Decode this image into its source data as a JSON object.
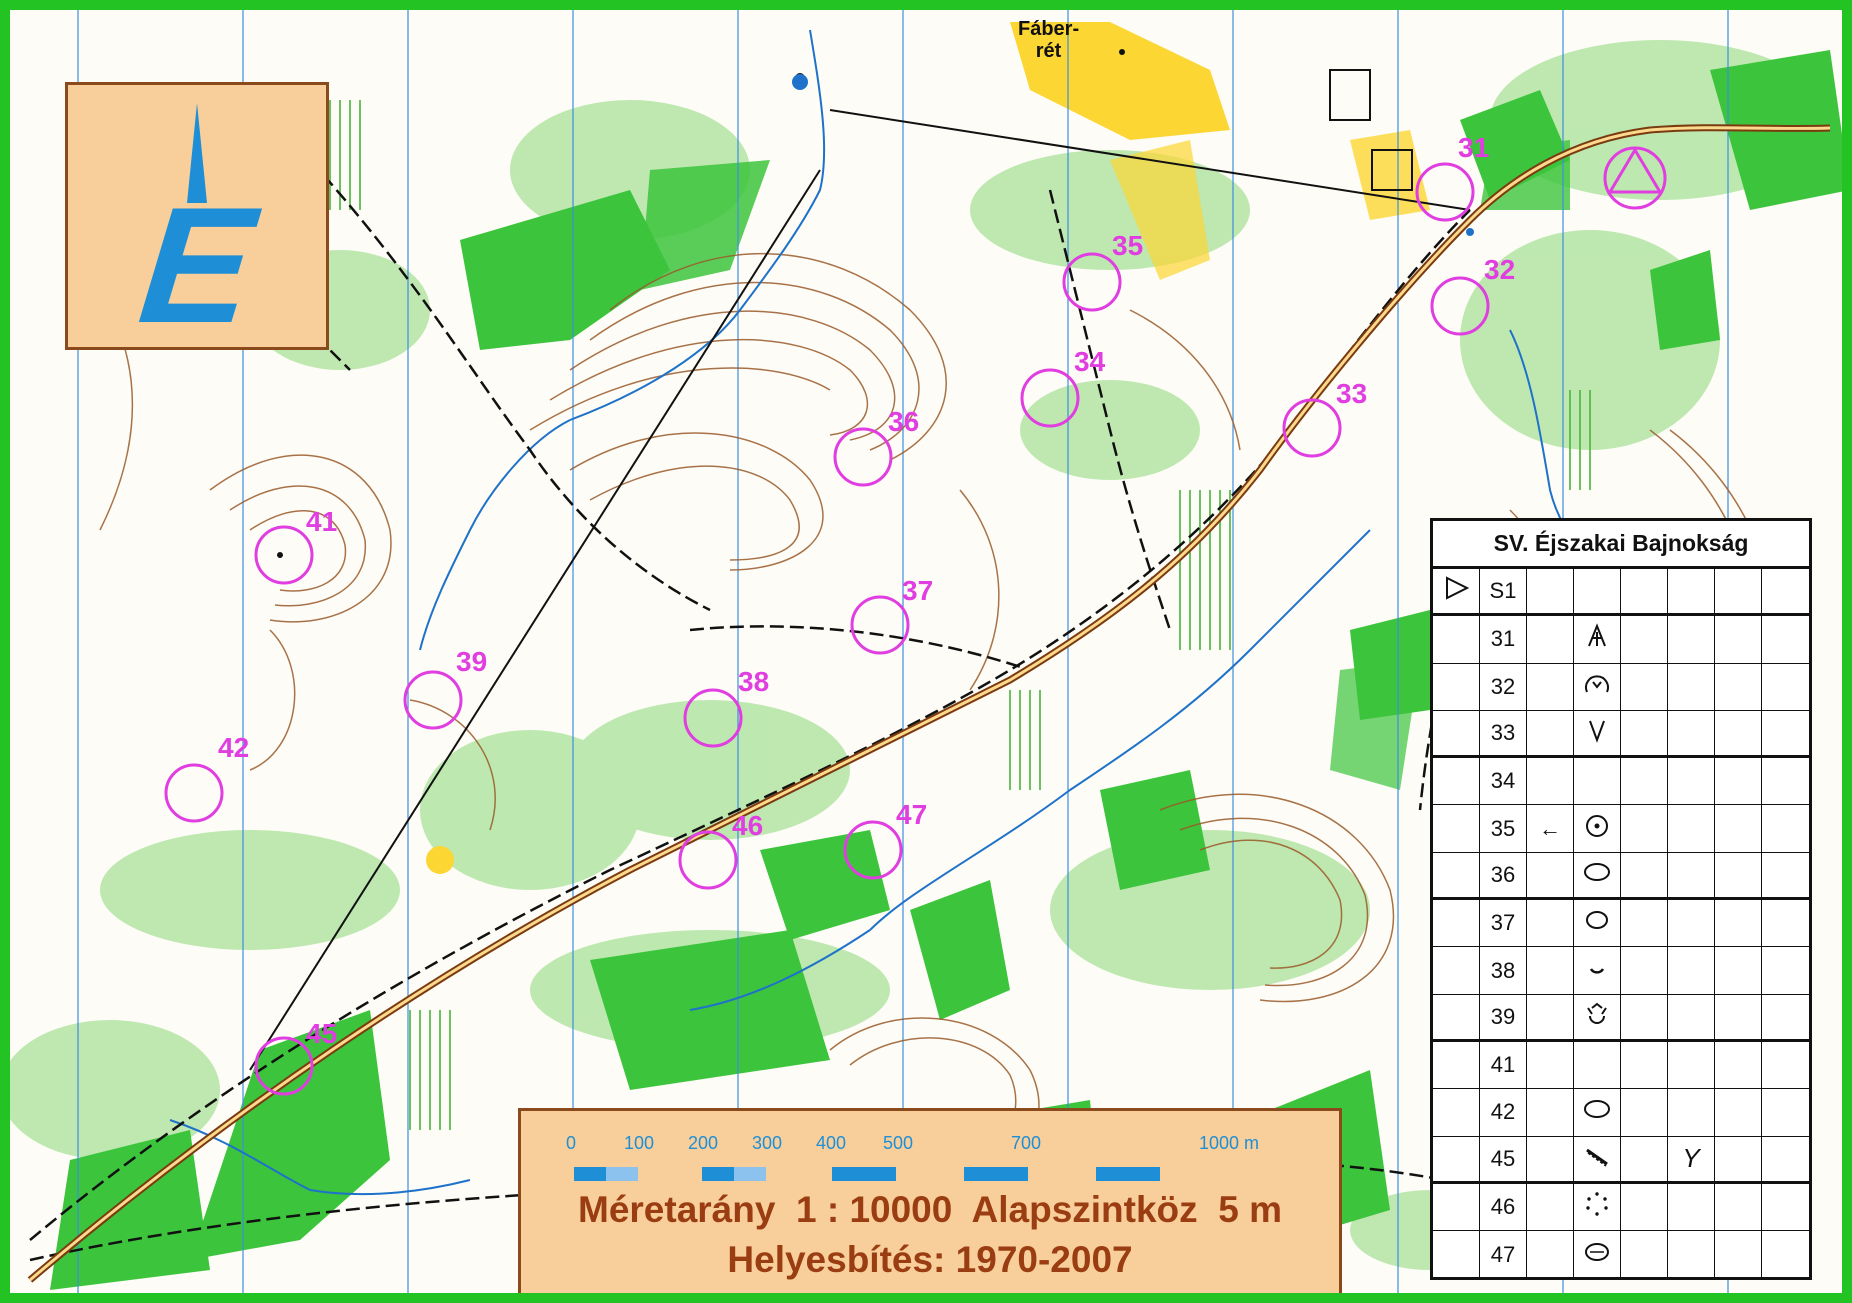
{
  "north_marker": {
    "letter": "E"
  },
  "place_labels": [
    "Fáber-",
    "rét"
  ],
  "controls": [
    "31",
    "32",
    "33",
    "34",
    "35",
    "36",
    "37",
    "38",
    "39",
    "41",
    "42",
    "45",
    "46",
    "47"
  ],
  "scale_box": {
    "ticks": [
      "0",
      "100",
      "200",
      "300",
      "400",
      "500",
      "700",
      "1000 m"
    ],
    "line1": "Méretarány  1 : 10000  Alapszintköz  5 m",
    "line2": "Helyesbítés: 1970-2007"
  },
  "control_descriptions": {
    "title": "SV. Éjszakai Bajnokság",
    "rows": [
      {
        "num": "S1",
        "dir": "",
        "feature": "start-triangle"
      },
      {
        "num": "31",
        "dir": "",
        "feature": "ruin-symbol"
      },
      {
        "num": "32",
        "dir": "",
        "feature": "reentrant-symbol"
      },
      {
        "num": "33",
        "dir": "",
        "feature": "gully-v-symbol"
      },
      {
        "num": "34",
        "dir": "",
        "feature": ""
      },
      {
        "num": "35",
        "dir": "←",
        "feature": "point-symbol"
      },
      {
        "num": "36",
        "dir": "",
        "feature": "knoll-symbol"
      },
      {
        "num": "37",
        "dir": "",
        "feature": "elongated-knoll-symbol"
      },
      {
        "num": "38",
        "dir": "",
        "feature": "depression-symbol"
      },
      {
        "num": "39",
        "dir": "",
        "feature": "pit-symbol"
      },
      {
        "num": "41",
        "dir": "",
        "feature": ""
      },
      {
        "num": "42",
        "dir": "",
        "feature": "knoll-symbol"
      },
      {
        "num": "45",
        "dir": "",
        "feature": "ditch-symbol",
        "extra": "Y"
      },
      {
        "num": "46",
        "dir": "",
        "feature": "vegetation-boundary-symbol"
      },
      {
        "num": "47",
        "dir": "",
        "feature": "small-knoll-symbol"
      }
    ]
  },
  "colors": {
    "border": "#22c322",
    "control_circle": "#e03ee0",
    "contour": "#8b4a1c",
    "forest_green": "#3cc43c",
    "light_green": "#a8e39b",
    "open_yellow": "#fcd633",
    "water_blue": "#1e8fd6"
  }
}
